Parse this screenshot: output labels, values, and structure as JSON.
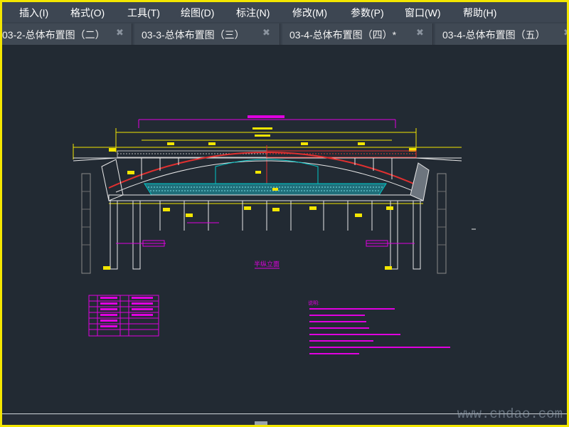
{
  "menu": {
    "items": [
      {
        "label": "插入(I)"
      },
      {
        "label": "格式(O)"
      },
      {
        "label": "工具(T)"
      },
      {
        "label": "绘图(D)"
      },
      {
        "label": "标注(N)"
      },
      {
        "label": "修改(M)"
      },
      {
        "label": "参数(P)"
      },
      {
        "label": "窗口(W)"
      },
      {
        "label": "帮助(H)"
      }
    ]
  },
  "tabs": [
    {
      "label": "03-2-总体布置图（二）",
      "close": "✖"
    },
    {
      "label": "03-3-总体布置图（三）",
      "close": "✖"
    },
    {
      "label": "03-4-总体布置图（四）*",
      "close": "✖"
    },
    {
      "label": "03-4-总体布置图（五）",
      "close": "✖"
    }
  ],
  "drawing": {
    "view_title": "半纵立面",
    "notes_heading": "说明:",
    "colors": {
      "background": "#222a33",
      "yellow": "#f3e600",
      "magenta": "#e000e0",
      "white": "#e8e8e8",
      "red": "#e03030",
      "cyan": "#00c8c8",
      "green": "#00c000"
    }
  },
  "watermark": "www.cndao.com"
}
